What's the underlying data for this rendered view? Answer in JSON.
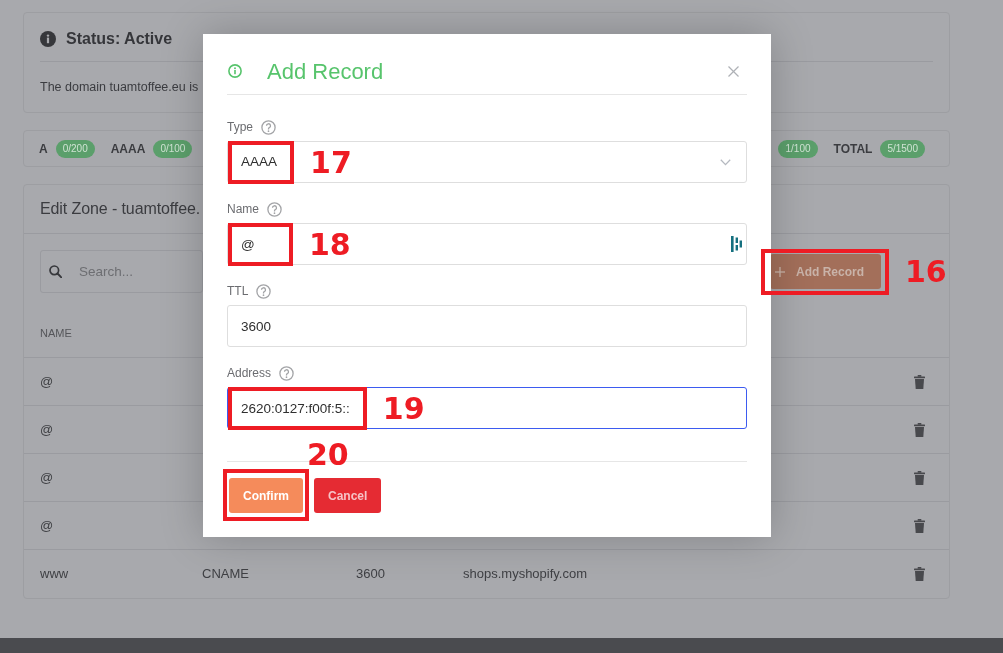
{
  "status_card": {
    "title": "Status: Active",
    "text": "The domain tuamtoffee.eu is"
  },
  "record_counts": [
    {
      "type": "A",
      "count": "0/200"
    },
    {
      "type": "AAAA",
      "count": "0/100"
    },
    {
      "count": "1/100"
    },
    {
      "type": "TOTAL",
      "count": "5/1500"
    }
  ],
  "zone_card": {
    "title": "Edit Zone - tuamtoffee.",
    "search": {
      "placeholder": "Search..."
    },
    "add_record_button": {
      "label": "Add Record",
      "annotation": "16"
    },
    "table": {
      "columns": [
        "NAME"
      ],
      "rows": [
        {
          "cells": [
            "@"
          ]
        },
        {
          "cells": [
            "@"
          ]
        },
        {
          "cells": [
            "@"
          ]
        },
        {
          "cells": [
            "@"
          ]
        },
        {
          "cells": [
            "www",
            "CNAME",
            "3600",
            "shops.myshopify.com"
          ]
        }
      ]
    }
  },
  "modal": {
    "title": "Add Record",
    "fields": [
      {
        "label": "Type",
        "kind": "select",
        "value": "AAAA",
        "focused": false,
        "autofill": false,
        "annotation": "17"
      },
      {
        "label": "Name",
        "kind": "text",
        "value": "@",
        "focused": false,
        "autofill": true,
        "annotation": "18"
      },
      {
        "label": "TTL",
        "kind": "text",
        "value": "3600",
        "focused": false,
        "autofill": false
      },
      {
        "label": "Address",
        "kind": "text",
        "value": "2620:0127:f00f:5::",
        "focused": true,
        "autofill": false,
        "annotation": "19"
      }
    ],
    "buttons": [
      {
        "label": "Confirm",
        "kind": "primary",
        "annotation": "20"
      },
      {
        "label": "Cancel",
        "kind": "danger"
      }
    ]
  }
}
